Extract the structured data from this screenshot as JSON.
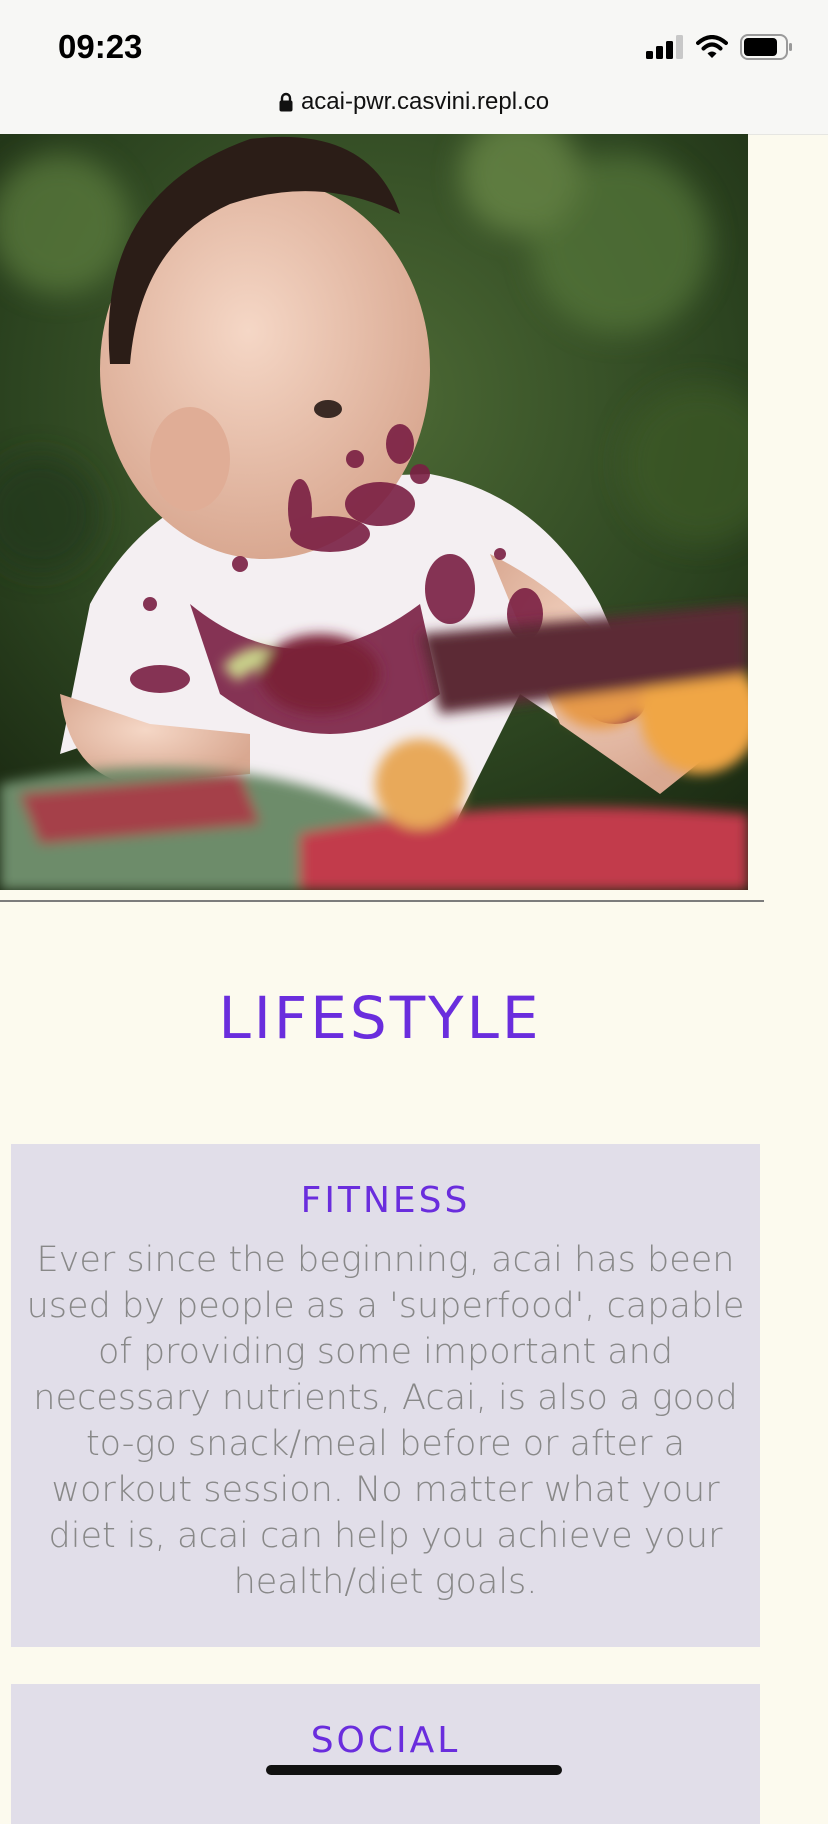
{
  "status_bar": {
    "time": "09:23"
  },
  "browser": {
    "url": "acai-pwr.casvini.repl.co"
  },
  "hero": {
    "alt": "Baby with acai smeared on face and shirt, sitting near a basket of fruit"
  },
  "lifestyle": {
    "title": "LIFESTYLE",
    "cards": [
      {
        "title": "FITNESS",
        "text": "Ever since the beginning, acai has been used by people as a 'superfood', capable of providing some important and necessary nutrients, Acai, is also a good to-go snack/meal before or after a workout session. No matter what your diet is, acai can help you achieve your health/diet goals."
      },
      {
        "title": "SOCIAL"
      }
    ]
  },
  "colors": {
    "page_background": "#fcfaee",
    "accent_purple": "#6a2ddd",
    "card_background": "#e1dee9",
    "body_text": "#888888"
  },
  "icons": [
    "signal-icon",
    "wifi-icon",
    "battery-icon",
    "lock-icon"
  ]
}
